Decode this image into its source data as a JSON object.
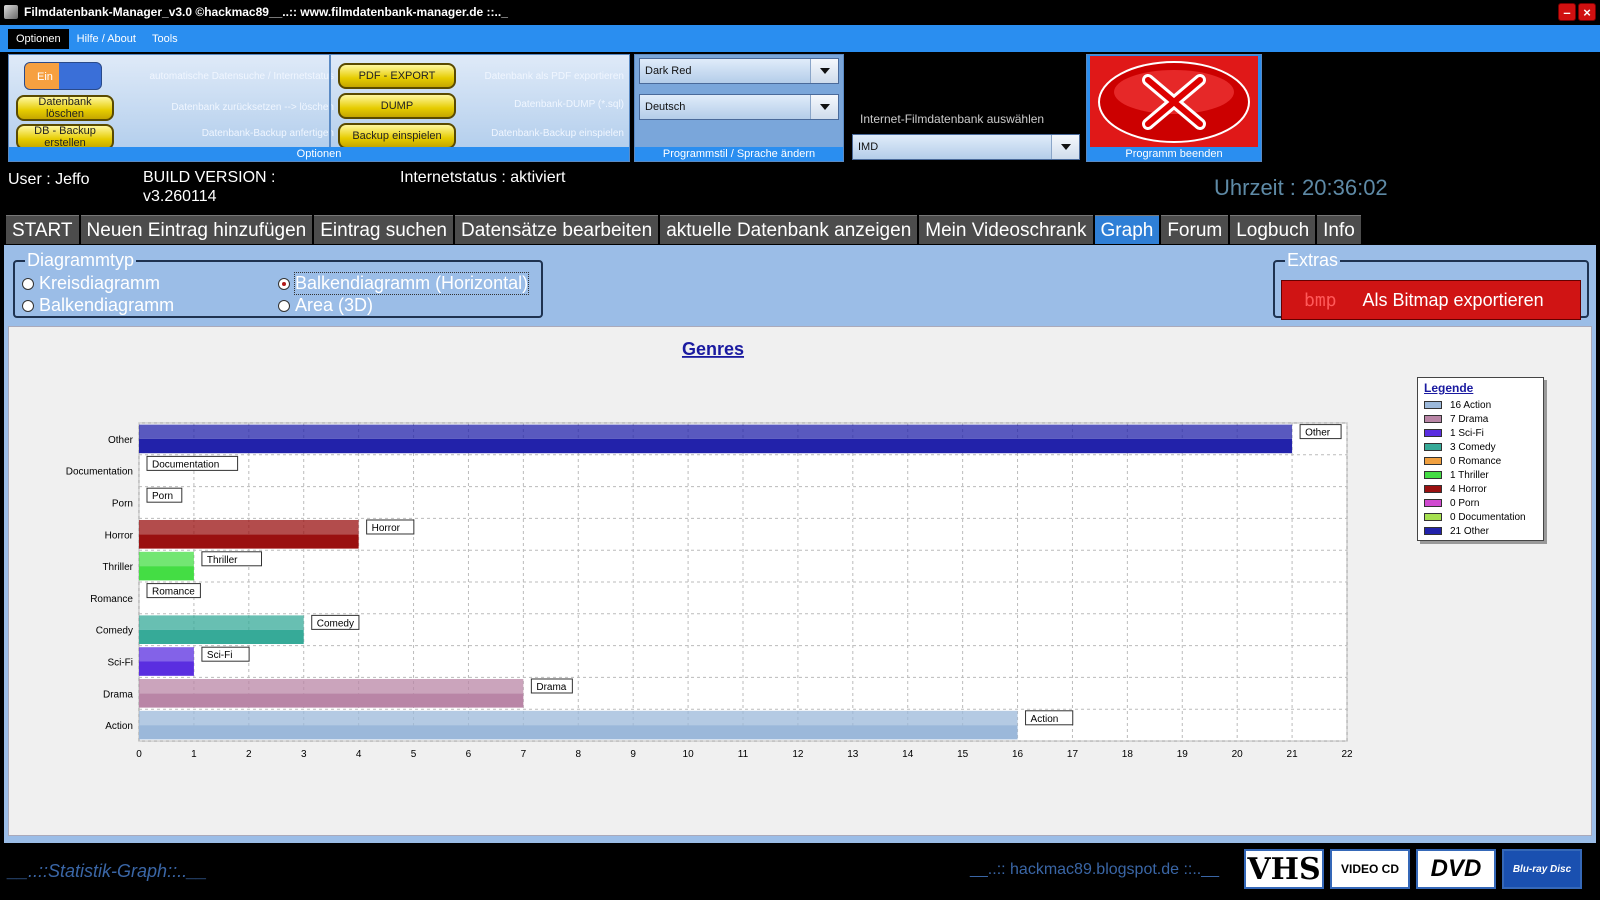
{
  "window": {
    "title": "Filmdatenbank-Manager_v3.0 ©hackmac89__..:: www.filmdatenbank-manager.de ::.._"
  },
  "menu": [
    {
      "label": "Optionen"
    },
    {
      "label": "Hilfe / About"
    },
    {
      "label": "Tools"
    }
  ],
  "ribbon": {
    "toggle_label": "Ein",
    "auto_search_text": "automatische Datensuche / Internetstatus",
    "delete_db_label": "Datenbank löschen",
    "reset_text": "Datenbank zurücksetzen --> löschen",
    "backup_label": "DB - Backup erstellen",
    "backup_text": "Datenbank-Backup anfertigen",
    "pdf_label": "PDF - EXPORT",
    "pdf_text": "Datenbank als PDF exportieren",
    "dump_label": "DUMP",
    "dump_text": "Datenbank-DUMP (*.sql)",
    "restore_label": "Backup einspielen",
    "restore_text": "Datenbank-Backup einspielen",
    "options_caption": "Optionen",
    "style_value": "Dark Red",
    "language_value": "Deutsch",
    "style_caption": "Programmstil / Sprache ändern",
    "imdb_heading": "Internet-Filmdatenbank auswählen",
    "imdb_value": "IMD",
    "exit_caption": "Programm beenden"
  },
  "status": {
    "user": "User : Jeffo",
    "build_label": "BUILD VERSION :",
    "build_value": "v3.260114",
    "internet": "Internetstatus : aktiviert",
    "clock": "Uhrzeit : 20:36:02"
  },
  "tabs": [
    {
      "label": "START"
    },
    {
      "label": "Neuen Eintrag hinzufügen"
    },
    {
      "label": "Eintrag suchen"
    },
    {
      "label": "Datensätze bearbeiten"
    },
    {
      "label": "aktuelle Datenbank anzeigen"
    },
    {
      "label": "Mein Videoschrank"
    },
    {
      "label": "Graph"
    },
    {
      "label": "Forum"
    },
    {
      "label": "Logbuch"
    },
    {
      "label": "Info"
    }
  ],
  "diagram_type": {
    "title": "Diagrammtyp",
    "options": {
      "pie": "Kreisdiagramm",
      "bar": "Balkendiagramm",
      "barh": "Balkendiagramm (Horizontal)",
      "area": "Area (3D)"
    },
    "selected": "Balkendiagramm (Horizontal)"
  },
  "extras": {
    "title": "Extras",
    "bmp_text": "bmp",
    "export_label": "Als Bitmap exportieren"
  },
  "colors": {
    "Action": "#9bb8da",
    "Drama": "#b985a6",
    "Sci-Fi": "#5a2ee0",
    "Comedy": "#36aa98",
    "Romance": "#f0a040",
    "Thriller": "#44dd44",
    "Horror": "#9a1010",
    "Porn": "#d04ad0",
    "Documentation": "#a6e050",
    "Other": "#2222aa"
  },
  "chart_data": {
    "type": "bar",
    "orientation": "horizontal",
    "title": "Genres",
    "categories": [
      "Action",
      "Drama",
      "Sci-Fi",
      "Comedy",
      "Romance",
      "Thriller",
      "Horror",
      "Porn",
      "Documentation",
      "Other"
    ],
    "values": [
      16,
      7,
      1,
      3,
      0,
      1,
      4,
      0,
      0,
      21
    ],
    "xlim": [
      0,
      22
    ],
    "x_ticks": [
      0,
      1,
      2,
      3,
      4,
      5,
      6,
      7,
      8,
      9,
      10,
      11,
      12,
      13,
      14,
      15,
      16,
      17,
      18,
      19,
      20,
      21,
      22
    ],
    "grid": true,
    "legend_title": "Legende",
    "legend_position": "right",
    "legend": [
      "16 Action",
      "7 Drama",
      "1 Sci-Fi",
      "3 Comedy",
      "0 Romance",
      "1 Thriller",
      "4 Horror",
      "0 Porn",
      "0 Documentation",
      "21 Other"
    ]
  },
  "footer": {
    "left": "__..::Statistik-Graph::..__",
    "mid": "__..:: hackmac89.blogspot.de ::..__",
    "logos": [
      "VHS",
      "VIDEO CD",
      "DVD",
      "Blu-ray Disc"
    ]
  }
}
